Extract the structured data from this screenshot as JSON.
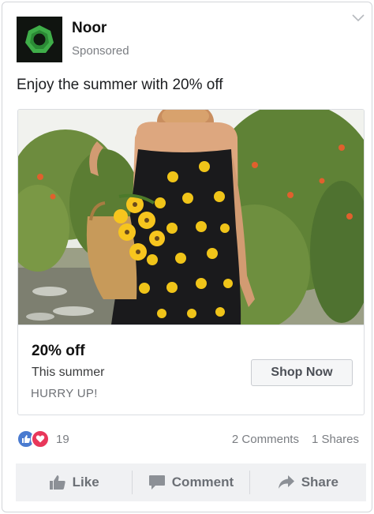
{
  "post": {
    "page_name": "Noor",
    "sponsored_label": "Sponsored",
    "message": "Enjoy the summer with 20% off"
  },
  "ad": {
    "image_alt": "Woman in black sunflower dress holding a basket with sunflowers",
    "headline": "20% off",
    "description": "This summer",
    "urgency_text": "HURRY UP!",
    "cta_label": "Shop Now"
  },
  "engagement": {
    "reaction_count": "19",
    "comments": "2 Comments",
    "shares": "1 Shares"
  },
  "actions": {
    "like": "Like",
    "comment": "Comment",
    "share": "Share"
  },
  "colors": {
    "brand_green": "#3fae49",
    "like_blue": "#4a7bd0",
    "love_red": "#e8375a",
    "action_bar": "#f0f1f3"
  },
  "icons": [
    "chevron-down-icon",
    "like-reaction-icon",
    "love-reaction-icon",
    "thumbs-up-icon",
    "comment-icon",
    "share-icon"
  ]
}
